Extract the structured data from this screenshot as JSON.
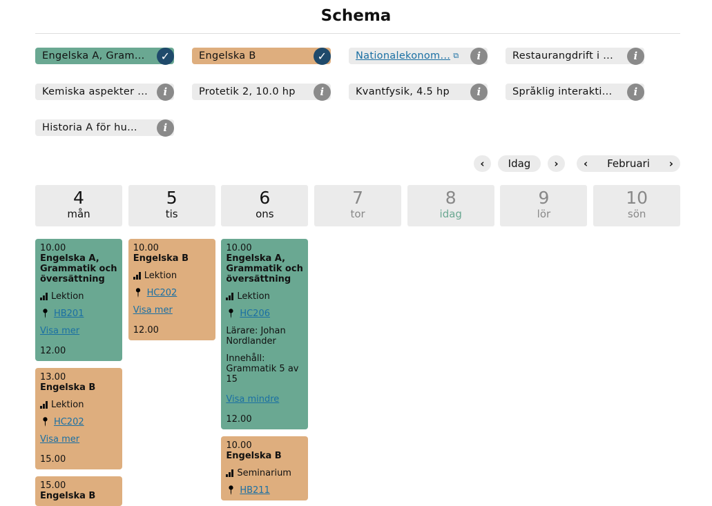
{
  "header": {
    "title": "Schema"
  },
  "courses": [
    {
      "label": "Engelska A, Gram...",
      "state": "selected",
      "color": "#6aa892",
      "icon": "check-icon"
    },
    {
      "label": "Engelska B",
      "state": "selected",
      "color": "#deae7e",
      "icon": "check-icon"
    },
    {
      "label": "Nationalekonom...",
      "state": "link",
      "icon": "info-icon",
      "external": true
    },
    {
      "label": "Restaurangdrift i ...",
      "icon": "info-icon"
    },
    {
      "label": "Kemiska aspekter ...",
      "icon": "info-icon"
    },
    {
      "label": "Protetik 2, 10.0 hp",
      "icon": "info-icon"
    },
    {
      "label": "Kvantfysik, 4.5 hp",
      "icon": "info-icon"
    },
    {
      "label": "Språklig interakti...",
      "icon": "info-icon"
    },
    {
      "label": "Historia A för hu...",
      "icon": "info-icon"
    }
  ],
  "nav": {
    "today": "Idag",
    "month": "Februari"
  },
  "days": [
    {
      "num": "4",
      "name": "mån",
      "state": "normal"
    },
    {
      "num": "5",
      "name": "tis",
      "state": "normal"
    },
    {
      "num": "6",
      "name": "ons",
      "state": "normal"
    },
    {
      "num": "7",
      "name": "tor",
      "state": "past"
    },
    {
      "num": "8",
      "name": "idag",
      "state": "today"
    },
    {
      "num": "9",
      "name": "lör",
      "state": "past"
    },
    {
      "num": "10",
      "name": "sön",
      "state": "past"
    }
  ],
  "colors": {
    "green": "#6aa892",
    "orange": "#deae7e",
    "link": "#1a6fa3",
    "check": "#1f4a6b"
  },
  "events": {
    "mon": [
      {
        "start": "10.00",
        "name": "Engelska A, Grammatik och översättning",
        "type": "Lektion",
        "room": "HB201",
        "toggle": "Visa mer",
        "end": "12.00",
        "color": "green"
      },
      {
        "start": "13.00",
        "name": "Engelska B",
        "type": "Lektion",
        "room": "HC202",
        "toggle": "Visa mer",
        "end": "15.00",
        "color": "orange"
      },
      {
        "start": "15.00",
        "name": "Engelska B",
        "color": "orange"
      }
    ],
    "tue": [
      {
        "start": "10.00",
        "name": "Engelska B",
        "type": "Lektion",
        "room": "HC202",
        "toggle": "Visa mer",
        "end": "12.00",
        "color": "orange"
      }
    ],
    "wed": [
      {
        "start": "10.00",
        "name": "Engelska A, Grammatik och översättning",
        "type": "Lektion",
        "room": "HC206",
        "teacher": "Lärare: Johan Nordlander",
        "content": "Innehåll: Grammatik 5 av 15",
        "toggle": "Visa mindre",
        "end": "12.00",
        "color": "green"
      },
      {
        "start": "10.00",
        "name": "Engelska B",
        "type": "Seminarium",
        "room": "HB211",
        "color": "orange"
      }
    ]
  }
}
